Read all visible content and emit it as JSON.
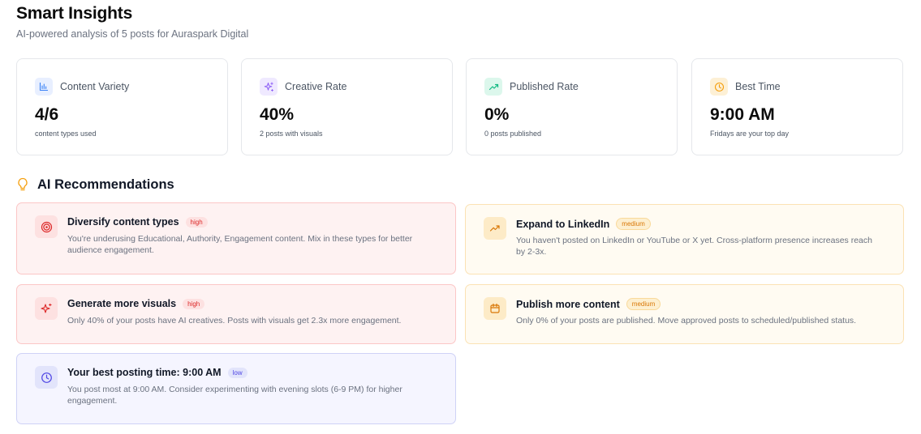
{
  "header": {
    "title": "Smart Insights",
    "subtitle": "AI-powered analysis of 5 posts for Auraspark Digital"
  },
  "stats": [
    {
      "label": "Content Variety",
      "value": "4/6",
      "caption": "content types used",
      "icon": "bar-chart-icon",
      "color": "#3b82f6"
    },
    {
      "label": "Creative Rate",
      "value": "40%",
      "caption": "2 posts with visuals",
      "icon": "sparkles-icon",
      "color": "#8b5cf6"
    },
    {
      "label": "Published Rate",
      "value": "0%",
      "caption": "0 posts published",
      "icon": "trending-up-icon",
      "color": "#10b981"
    },
    {
      "label": "Best Time",
      "value": "9:00 AM",
      "caption": "Fridays are your top day",
      "icon": "clock-icon",
      "color": "#f59e0b"
    }
  ],
  "recommendations": {
    "title": "AI Recommendations",
    "icon": "lightbulb-icon",
    "items": [
      {
        "title": "Diversify content types",
        "priority": "high",
        "icon": "target-icon",
        "description": "You're underusing Educational, Authority, Engagement content. Mix in these types for better audience engagement."
      },
      {
        "title": "Expand to LinkedIn",
        "priority": "medium",
        "icon": "trending-up-icon",
        "description": "You haven't posted on LinkedIn or YouTube or X yet. Cross-platform presence increases reach by 2-3x."
      },
      {
        "title": "Generate more visuals",
        "priority": "high",
        "icon": "sparkles-icon",
        "description": "Only 40% of your posts have AI creatives. Posts with visuals get 2.3x more engagement."
      },
      {
        "title": "Publish more content",
        "priority": "medium",
        "icon": "calendar-icon",
        "description": "Only 0% of your posts are published. Move approved posts to scheduled/published status."
      },
      {
        "title": "Your best posting time: 9:00 AM",
        "priority": "low",
        "icon": "clock-icon",
        "description": "You post most at 9:00 AM. Consider experimenting with evening slots (6-9 PM) for higher engagement."
      }
    ]
  },
  "colors": {
    "high": "#dc2626",
    "medium": "#d97706",
    "low": "#4f46e5"
  }
}
